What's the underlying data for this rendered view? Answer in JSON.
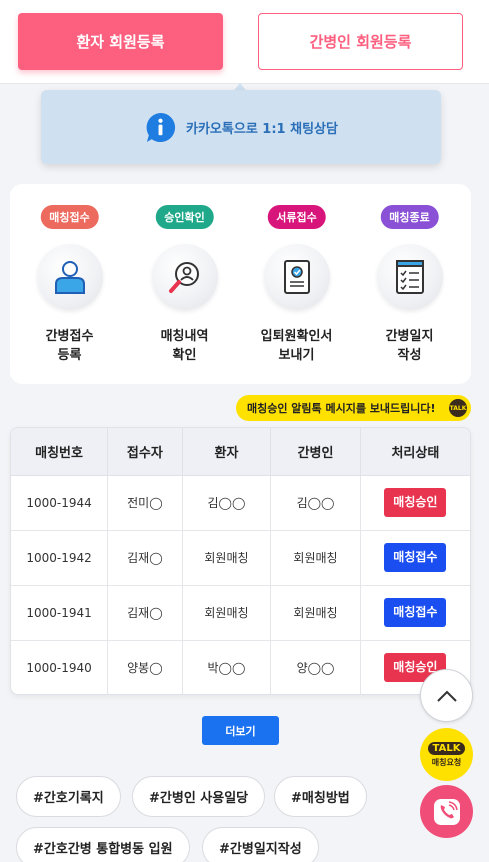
{
  "header": {
    "patient_signup": "환자 회원등록",
    "caregiver_signup": "간병인 회원등록"
  },
  "kakao": {
    "label": "카카오톡으로 1:1 채팅상담",
    "icon": "info-chat-icon"
  },
  "steps": [
    {
      "badge": "매칭접수",
      "badge_color": "#ec6a5e",
      "icon": "person-icon",
      "label_line1": "간병접수",
      "label_line2": "등록"
    },
    {
      "badge": "승인확인",
      "badge_color": "#1fa98a",
      "icon": "magnifier-person-icon",
      "label_line1": "매칭내역",
      "label_line2": "확인"
    },
    {
      "badge": "서류접수",
      "badge_color": "#d8157a",
      "icon": "document-icon",
      "label_line1": "입퇴원확인서",
      "label_line2": "보내기"
    },
    {
      "badge": "매칭종료",
      "badge_color": "#8a50d6",
      "icon": "checklist-icon",
      "label_line1": "간병일지",
      "label_line2": "작성"
    }
  ],
  "notice": {
    "text": "매칭승인 알림톡 메시지를 보내드립니다!",
    "badge": "TALK"
  },
  "table": {
    "headers": [
      "매칭번호",
      "접수자",
      "환자",
      "간병인",
      "처리상태"
    ],
    "rows": [
      {
        "no": "1000-1944",
        "receiver": "전미◯",
        "patient": "김◯◯",
        "caregiver": "김◯◯",
        "status": "매칭승인",
        "status_color": "#e8344f"
      },
      {
        "no": "1000-1942",
        "receiver": "김재◯",
        "patient": "회원매칭",
        "caregiver": "회원매칭",
        "status": "매칭접수",
        "status_color": "#1b4ef0"
      },
      {
        "no": "1000-1941",
        "receiver": "김재◯",
        "patient": "회원매칭",
        "caregiver": "회원매칭",
        "status": "매칭접수",
        "status_color": "#1b4ef0"
      },
      {
        "no": "1000-1940",
        "receiver": "양봉◯",
        "patient": "박◯◯",
        "caregiver": "양◯◯",
        "status": "매칭승인",
        "status_color": "#e8344f"
      }
    ]
  },
  "more_button": "더보기",
  "tags": [
    "#간호기록지",
    "#간병인 사용일당",
    "#매칭방법",
    "#간호간병 통합병동 입원",
    "#간병일지작성"
  ],
  "floating": {
    "up_icon": "chevron-up-icon",
    "talk_label": "TALK",
    "talk_sub": "매칭요청",
    "call_icon": "phone-icon"
  }
}
